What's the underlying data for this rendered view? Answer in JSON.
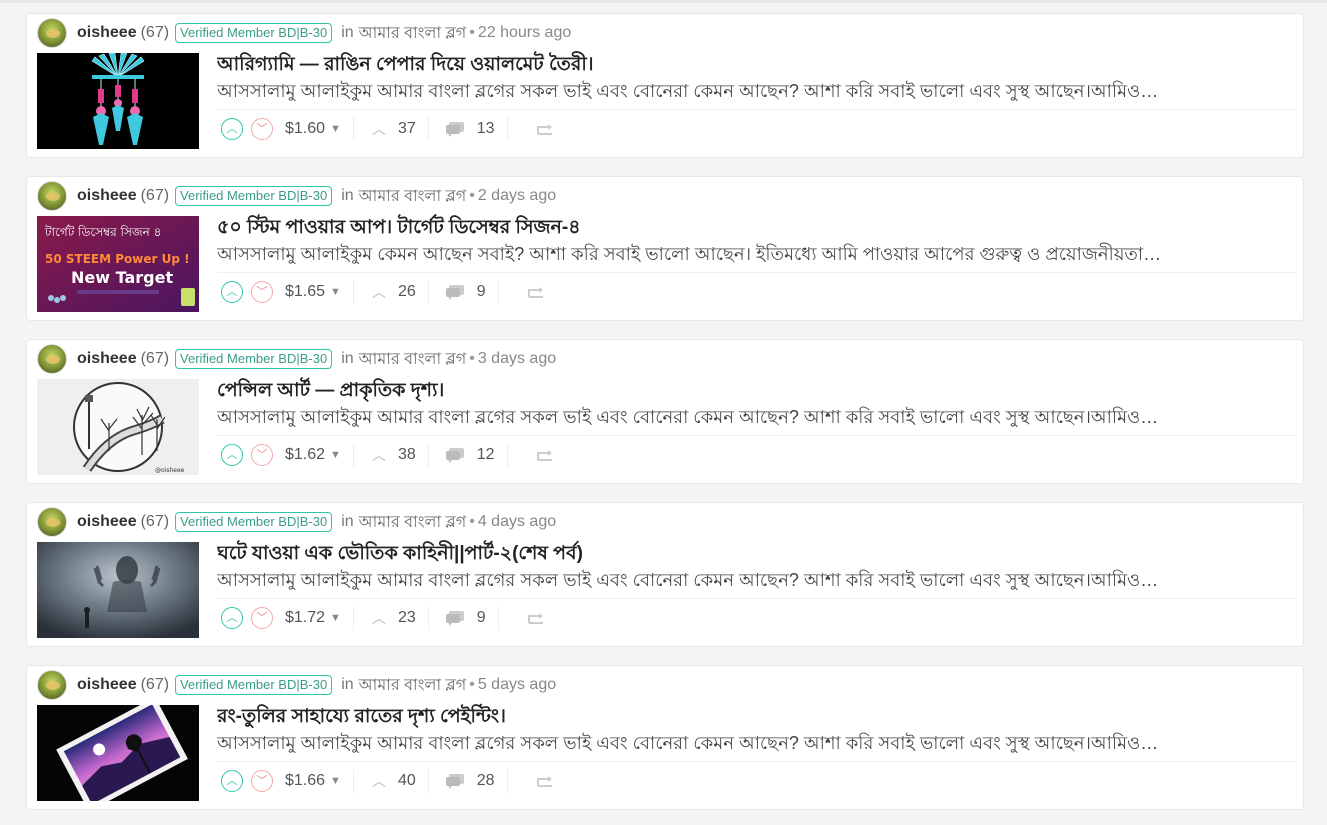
{
  "posts": [
    {
      "author": "oisheee",
      "reputation": "(67)",
      "badge": "Verified Member BD|B-30",
      "in_label": "in",
      "community": "আমার বাংলা ব্লগ",
      "time": "22 hours ago",
      "title": "আরিগ্যামি — রাঙিন পেপার দিয়ে ওয়ালমেট তৈরী।",
      "summary": "আসসালামু আলাইকুম আমার বাংলা ব্লগের সকল ভাই এবং বোনেরা কেমন আছেন? আশা করি সবাই ভালো এবং সুস্থ আছেন।আমিও…",
      "payout": "$1.60",
      "votes": "37",
      "comments": "13",
      "thumb": "origami"
    },
    {
      "author": "oisheee",
      "reputation": "(67)",
      "badge": "Verified Member BD|B-30",
      "in_label": "in",
      "community": "আমার বাংলা ব্লগ",
      "time": "2 days ago",
      "title": "৫০ স্টিম পাওয়ার আপ। টার্গেট ডিসেম্বর সিজন-৪",
      "summary": "আসসালামু আলাইকুম কেমন আছেন সবাই? আশা করি সবাই ভালো আছেন। ইতিমধ্যে আমি পাওয়ার আপের গুরুত্ব ও প্রয়োজনীয়তা…",
      "payout": "$1.65",
      "votes": "26",
      "comments": "9",
      "thumb": "powerup",
      "thumb_text": {
        "line1": "টার্গেট ডিসেম্বর সিজন ৪",
        "line2": "50 STEEM Power Up !",
        "line3": "New Target"
      }
    },
    {
      "author": "oisheee",
      "reputation": "(67)",
      "badge": "Verified Member BD|B-30",
      "in_label": "in",
      "community": "আমার বাংলা ব্লগ",
      "time": "3 days ago",
      "title": "পেন্সিল আর্ট — প্রাকৃতিক দৃশ্য।",
      "summary": "আসসালামু আলাইকুম আমার বাংলা ব্লগের সকল ভাই এবং বোনেরা কেমন আছেন? আশা করি সবাই ভালো এবং সুস্থ আছেন।আমিও…",
      "payout": "$1.62",
      "votes": "38",
      "comments": "12",
      "thumb": "pencil"
    },
    {
      "author": "oisheee",
      "reputation": "(67)",
      "badge": "Verified Member BD|B-30",
      "in_label": "in",
      "community": "আমার বাংলা ব্লগ",
      "time": "4 days ago",
      "title": "ঘটে যাওয়া এক ভৌতিক কাহিনী||পার্ট-২(শেষ পর্ব)",
      "summary": "আসসালামু আলাইকুম আমার বাংলা ব্লগের সকল ভাই এবং বোনেরা কেমন আছেন? আশা করি সবাই ভালো এবং সুস্থ আছেন।আমিও…",
      "payout": "$1.72",
      "votes": "23",
      "comments": "9",
      "thumb": "ghost"
    },
    {
      "author": "oisheee",
      "reputation": "(67)",
      "badge": "Verified Member BD|B-30",
      "in_label": "in",
      "community": "আমার বাংলা ব্লগ",
      "time": "5 days ago",
      "title": "রং-তুলির সাহায্যে রাতের দৃশ্য পেইন্টিং।",
      "summary": "আসসালামু আলাইকুম আমার বাংলা ব্লগের সকল ভাই এবং বোনেরা কেমন আছেন? আশা করি সবাই ভালো এবং সুস্থ আছেন।আমিও…",
      "payout": "$1.66",
      "votes": "40",
      "comments": "28",
      "thumb": "painting"
    }
  ],
  "colors": {
    "upvote": "#2dc6a7",
    "downvote": "#f08080",
    "badge_border": "#2dc6a7"
  },
  "icons": [
    "upvote-icon",
    "downvote-icon",
    "dropdown-caret-icon",
    "votes-chevron-icon",
    "comments-icon",
    "reblog-icon"
  ]
}
